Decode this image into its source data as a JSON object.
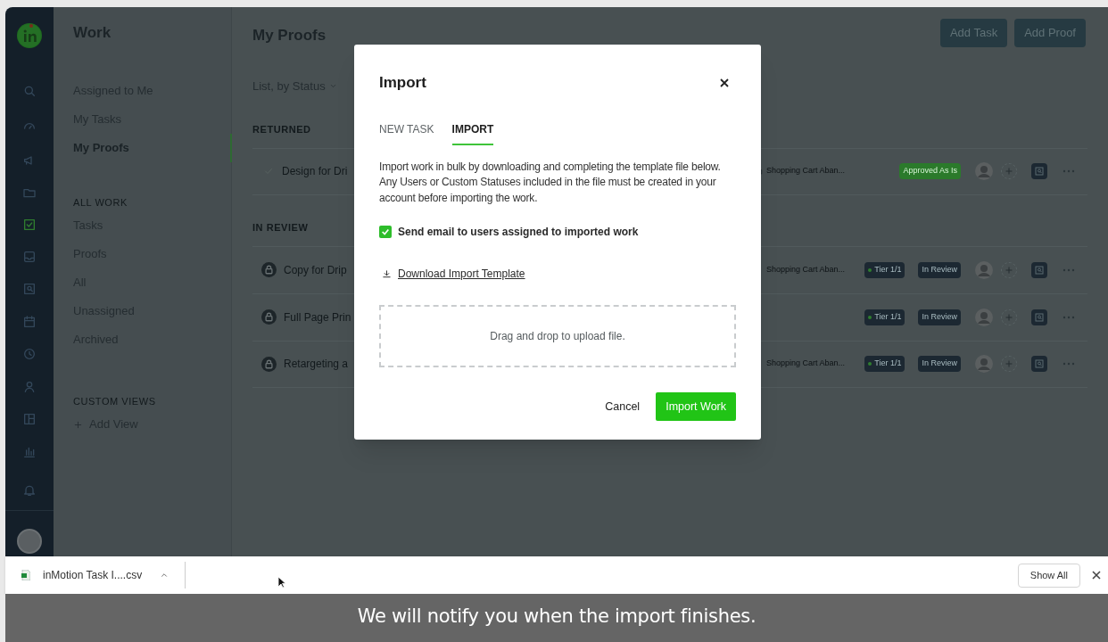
{
  "rail": {
    "items": [
      {
        "selected": false
      },
      {
        "selected": false
      },
      {
        "selected": false
      },
      {
        "selected": false
      },
      {
        "selected": true
      },
      {
        "selected": false
      },
      {
        "selected": false
      },
      {
        "selected": false
      },
      {
        "selected": false
      },
      {
        "selected": false
      },
      {
        "selected": false
      },
      {
        "selected": false
      },
      {
        "selected": false
      }
    ]
  },
  "sidebar": {
    "title": "Work",
    "groups": [
      {
        "items": [
          {
            "label": "Assigned to Me",
            "selected": false
          },
          {
            "label": "My Tasks",
            "selected": false
          },
          {
            "label": "My Proofs",
            "selected": true
          }
        ]
      },
      {
        "heading": "ALL WORK",
        "items": [
          {
            "label": "Tasks",
            "selected": false
          },
          {
            "label": "Proofs",
            "selected": false
          },
          {
            "label": "All",
            "selected": false
          },
          {
            "label": "Unassigned",
            "selected": false
          },
          {
            "label": "Archived",
            "selected": false
          }
        ]
      },
      {
        "heading": "CUSTOM VIEWS",
        "add_label": "Add View"
      }
    ]
  },
  "main": {
    "title": "My Proofs",
    "buttons": [
      "Add Task",
      "Add Proof"
    ],
    "view_selector": "List, by Status",
    "sections": [
      {
        "heading": "RETURNED",
        "rows": [
          {
            "kind": "done",
            "title": "Design for Dri",
            "project": "Shopping Cart Aban...",
            "badges": [
              {
                "kind": "approved",
                "label": "Approved As Is"
              }
            ]
          }
        ]
      },
      {
        "heading": "IN REVIEW",
        "rows": [
          {
            "kind": "locked",
            "title": "Copy for Drip",
            "project": "Shopping Cart Aban...",
            "badges": [
              {
                "kind": "tier",
                "label": "Tier 1/1"
              },
              {
                "kind": "status",
                "label": "In Review"
              }
            ]
          },
          {
            "kind": "locked",
            "title": "Full Page Prin",
            "badges": [
              {
                "kind": "tier",
                "label": "Tier 1/1"
              },
              {
                "kind": "status",
                "label": "In Review"
              }
            ]
          },
          {
            "kind": "locked",
            "title": "Retargeting a",
            "project": "Shopping Cart Aban...",
            "badges": [
              {
                "kind": "tier",
                "label": "Tier 1/1"
              },
              {
                "kind": "status",
                "label": "In Review"
              }
            ]
          }
        ]
      }
    ]
  },
  "modal": {
    "title": "Import",
    "tabs": [
      {
        "label": "NEW TASK",
        "selected": false
      },
      {
        "label": "IMPORT",
        "selected": true
      }
    ],
    "description": "Import work in bulk by downloading and completing the template file below. Any Users or Custom Statuses included in the file must be created in your account before importing the work.",
    "checkbox": {
      "label": "Send email to users assigned to imported work",
      "checked": true
    },
    "download_link": "Download Import Template",
    "dropzone": "Drag and drop to upload file.",
    "buttons": [
      {
        "kind": "secondary",
        "label": "Cancel"
      },
      {
        "kind": "primary",
        "label": "Import Work"
      }
    ]
  },
  "download_bar": {
    "file": "inMotion Task I....csv",
    "show_all": "Show All"
  },
  "caption": "We will notify you when the import finishes."
}
